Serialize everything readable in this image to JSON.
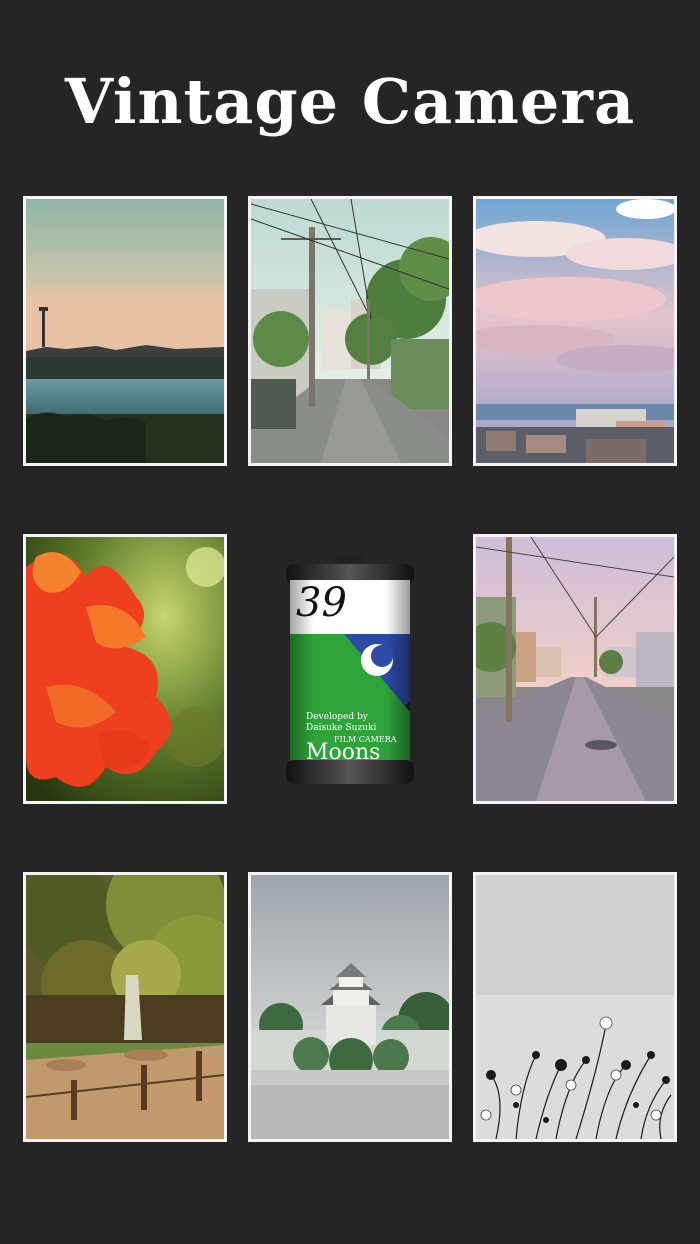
{
  "app": {
    "title": "Vintage Camera"
  },
  "photos": [
    {
      "subject": "river at dusk"
    },
    {
      "subject": "street with utility poles"
    },
    {
      "subject": "pink clouds over houses"
    },
    {
      "subject": "red flower"
    },
    {
      "subject": "road at sunset"
    },
    {
      "subject": "waterfall garden"
    },
    {
      "subject": "castle"
    },
    {
      "subject": "cosmos flowers monochrome"
    }
  ],
  "film_roll": {
    "count": "39",
    "developer_line1": "Developed by",
    "developer_line2": "Daisuke Suzuki",
    "brand_small": "FILM CAMERA",
    "brand_large": "Moons"
  },
  "colors": {
    "background": "#252525",
    "frame": "#f4f4f4",
    "film_green": "#2ea33a",
    "film_blue": "#2c4aa6"
  }
}
